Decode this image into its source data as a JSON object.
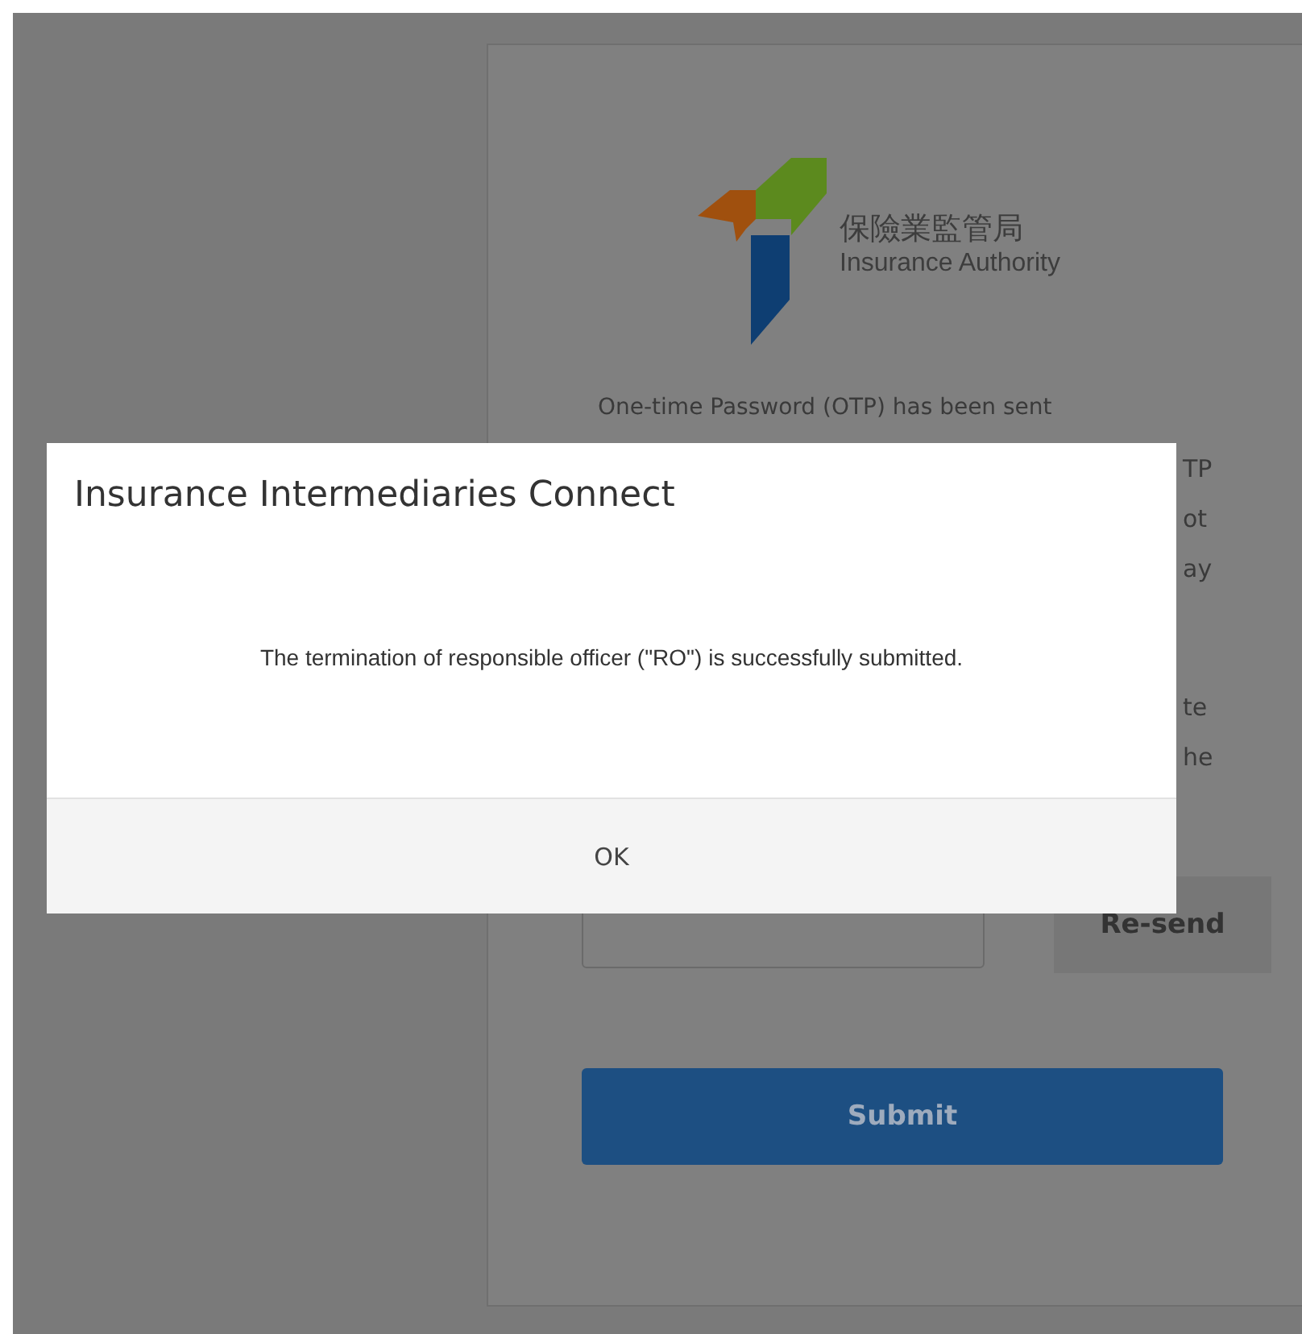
{
  "logo": {
    "chinese_name": "保險業監管局",
    "english_name": "Insurance Authority"
  },
  "otp_text": {
    "first_line": "One-time Password (OTP) has been sent",
    "line_fragments": [
      "TP",
      "ot",
      "ay",
      "te",
      "he"
    ]
  },
  "resend_button": "Re-send",
  "submit_button": "Submit",
  "dialog": {
    "title": "Insurance Intermediaries Connect",
    "message": "The termination of responsible officer (\"RO\") is successfully submitted.",
    "ok_button": "OK"
  }
}
